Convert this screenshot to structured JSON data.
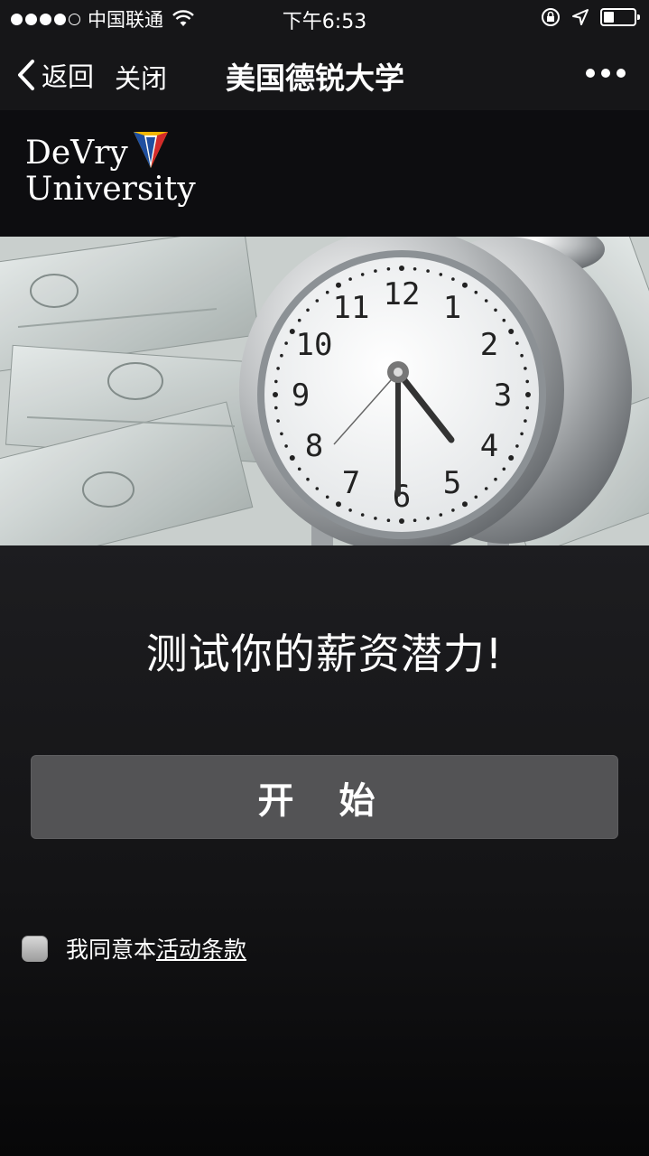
{
  "status_bar": {
    "carrier": "中国联通",
    "time": "下午6:53",
    "battery_level": 0.35
  },
  "nav": {
    "back_label": "返回",
    "close_label": "关闭",
    "title": "美国德锐大学"
  },
  "logo": {
    "line1": "DeVry",
    "line2": "University"
  },
  "hero": {
    "clock_numbers": [
      "12",
      "1",
      "2",
      "3",
      "4",
      "5",
      "6",
      "7",
      "8",
      "9",
      "10",
      "11"
    ]
  },
  "main": {
    "headline": "测试你的薪资潜力!",
    "start_button": "开 始",
    "agree_text": "我同意本",
    "terms_link": "活动条款"
  },
  "colors": {
    "background": "#0b0b0d",
    "nav_bar": "#161618",
    "button": "#535355",
    "logo_blue": "#1f4fa0",
    "logo_red": "#d22a2a",
    "logo_yellow": "#f2b705"
  }
}
